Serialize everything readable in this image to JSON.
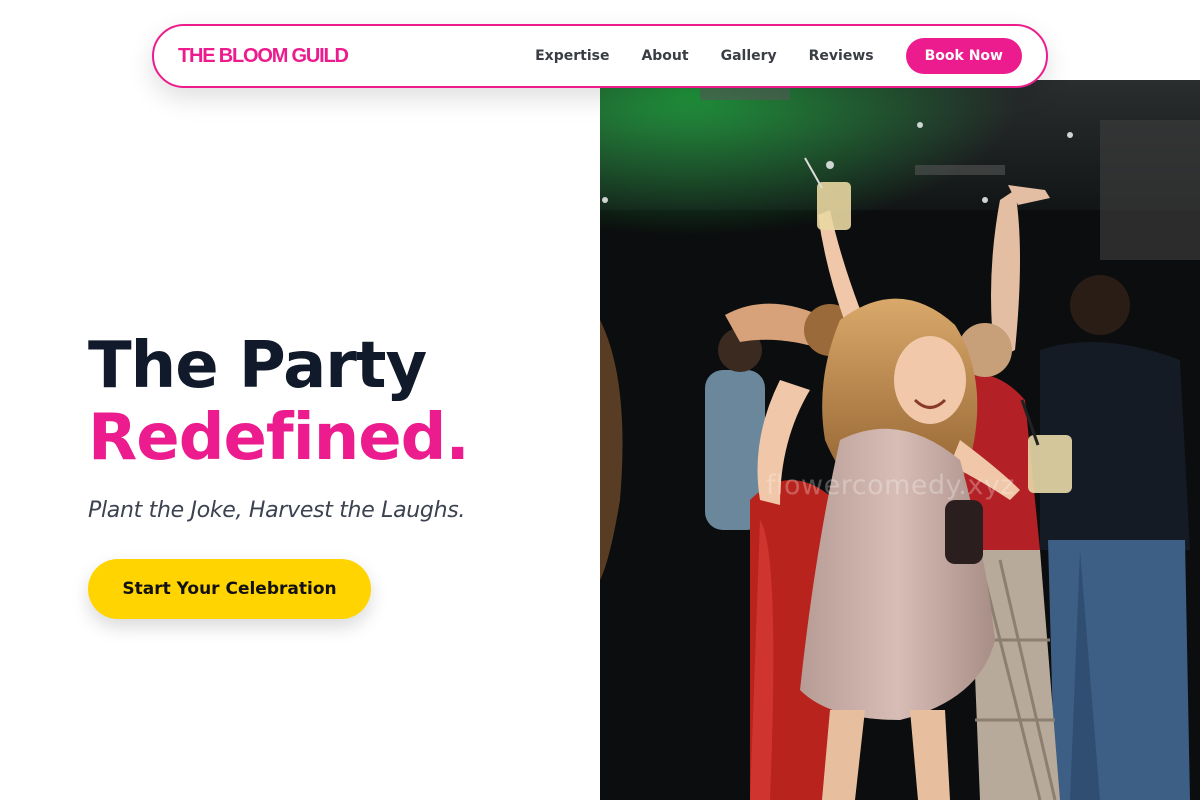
{
  "brand": {
    "name": "THE BLOOM GUILD",
    "color": "#ec1c8e"
  },
  "nav": {
    "links": [
      {
        "label": "Expertise"
      },
      {
        "label": "About"
      },
      {
        "label": "Gallery"
      },
      {
        "label": "Reviews"
      }
    ],
    "cta_label": "Book Now"
  },
  "hero": {
    "title_line_1": "The Party",
    "title_line_2": "Redefined.",
    "tagline": "Plant the Joke, Harvest the Laughs.",
    "cta_label": "Start Your Celebration",
    "cta_color": "#ffd400"
  },
  "photo": {
    "subject": "party-dancers-photo",
    "watermark": "flowercomedy.xyz"
  },
  "colors": {
    "accent": "#ec1c8e",
    "heading": "#111a2b",
    "text": "#3c4250"
  }
}
